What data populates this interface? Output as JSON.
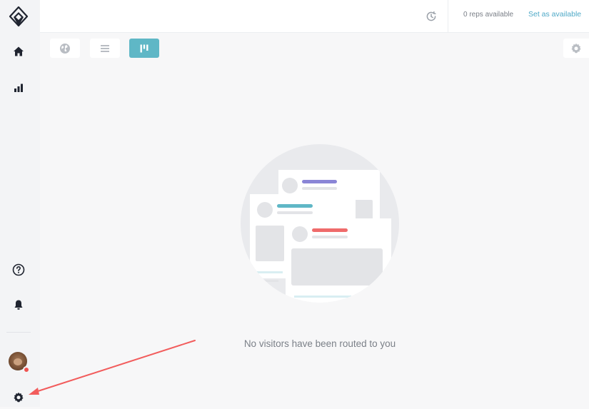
{
  "sidebar": {
    "logo": "logo-icon",
    "items": [
      {
        "icon": "home-icon"
      },
      {
        "icon": "bar-chart-icon"
      }
    ],
    "bottom": [
      {
        "icon": "help-icon"
      },
      {
        "icon": "bell-icon"
      },
      {
        "icon": "avatar"
      },
      {
        "icon": "gear-icon"
      }
    ]
  },
  "topbar": {
    "reps_available": "0 reps available",
    "set_available_label": "Set as available",
    "history_icon": "history-icon"
  },
  "toolbar": {
    "views": [
      {
        "icon": "globe-icon",
        "active": false
      },
      {
        "icon": "list-icon",
        "active": false
      },
      {
        "icon": "kanban-icon",
        "active": true
      }
    ],
    "settings_icon": "gear-icon"
  },
  "empty_state": {
    "message": "No visitors have been routed to you"
  },
  "colors": {
    "accent": "#5fb7c6",
    "link": "#4ea9c7",
    "status_dot": "#ef5350",
    "annotation_arrow": "#f25c5c"
  }
}
